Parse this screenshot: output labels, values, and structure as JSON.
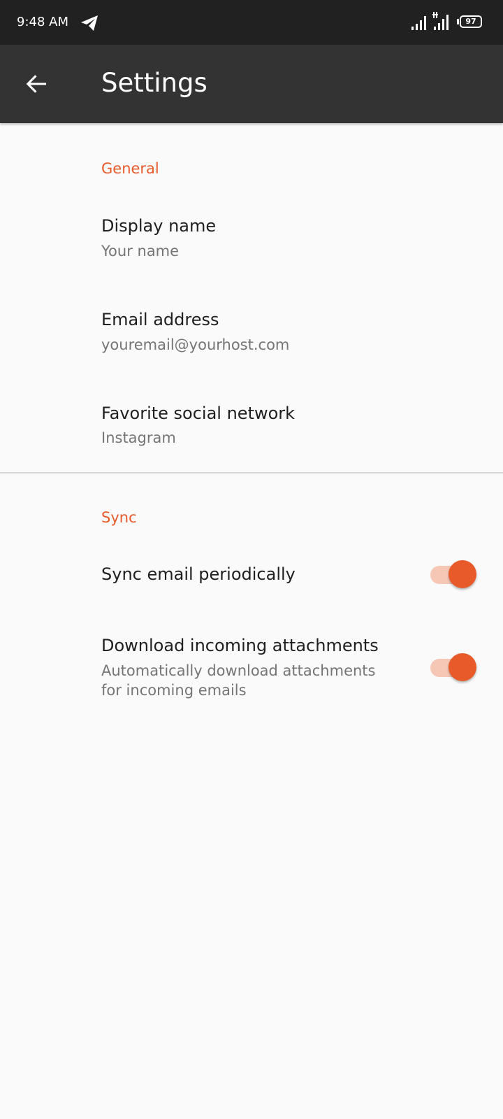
{
  "status_bar": {
    "time": "9:48 AM",
    "battery": "97",
    "icons": [
      "telegram-icon",
      "cellular-signal-icon",
      "cellular-signal-data-icon",
      "battery-icon"
    ]
  },
  "app_bar": {
    "title": "Settings",
    "back_icon": "arrow-back-icon"
  },
  "colors": {
    "accent": "#e85a2a",
    "toolbar": "#333333",
    "status_bar": "#212121",
    "background": "#fafafa"
  },
  "general": {
    "title": "General",
    "items": [
      {
        "title": "Display name",
        "summary": "Your name"
      },
      {
        "title": "Email address",
        "summary": "youremail@yourhost.com"
      },
      {
        "title": "Favorite social network",
        "summary": "Instagram"
      }
    ]
  },
  "sync": {
    "title": "Sync",
    "items": [
      {
        "title": "Sync email periodically",
        "checked": true
      },
      {
        "title": "Download incoming attachments",
        "summary": "Automatically download attachments for incoming emails",
        "checked": true
      }
    ]
  }
}
